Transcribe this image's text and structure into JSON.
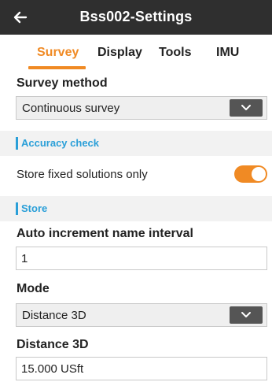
{
  "header": {
    "title": "Bss002-Settings",
    "back_icon": "arrow-left-icon"
  },
  "tabs": [
    {
      "label": "Survey",
      "active": true
    },
    {
      "label": "Display",
      "active": false
    },
    {
      "label": "Tools",
      "active": false
    },
    {
      "label": "IMU",
      "active": false
    }
  ],
  "survey_method": {
    "label": "Survey method",
    "value": "Continuous survey"
  },
  "accuracy_check": {
    "header": "Accuracy check"
  },
  "store_fixed": {
    "label": "Store fixed solutions only",
    "enabled": true
  },
  "store": {
    "header": "Store",
    "auto_increment": {
      "label": "Auto increment name interval",
      "value": "1"
    },
    "mode": {
      "label": "Mode",
      "value": "Distance 3D"
    },
    "distance": {
      "label": "Distance 3D",
      "value": "15.000 USft"
    }
  },
  "colors": {
    "accent": "#f08a24",
    "section": "#2a9fd8",
    "titlebar": "#2f2f2f"
  }
}
